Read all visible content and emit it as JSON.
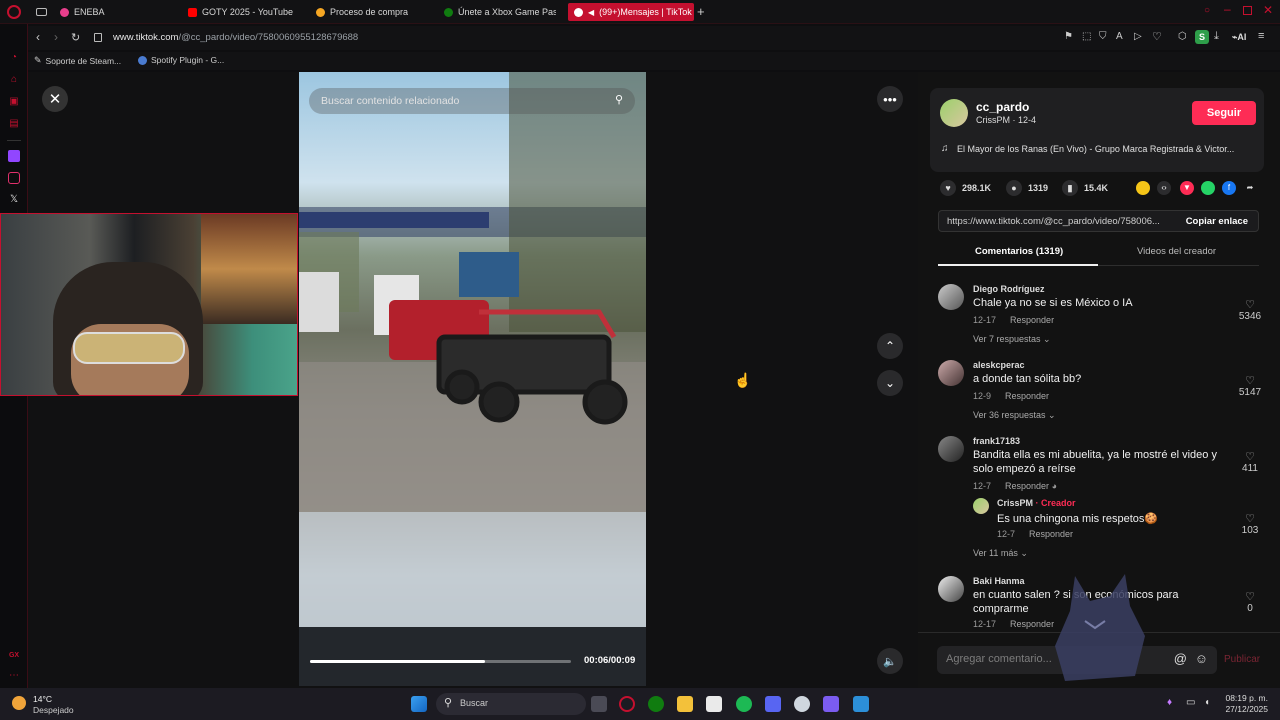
{
  "browser": {
    "tabs": [
      {
        "label": "ENEBA",
        "color": "#e83e8c"
      },
      {
        "label": "GOTY 2025 - YouTube",
        "color": "#ff0000"
      },
      {
        "label": "Proceso de compra",
        "color": "#f5a623"
      },
      {
        "label": "Únete a Xbox Game Pass",
        "color": "#107c10"
      },
      {
        "label": "(99+)Mensajes | TikTok",
        "color": "#ffffff"
      }
    ],
    "url_host": "www.tiktok.com",
    "url_path": "/@cc_pardo/video/7580060955128679688",
    "bookmarks": [
      "Soporte de Steam...",
      "Spotify Plugin - G..."
    ],
    "ai_label": "AI",
    "profile_initial": "S"
  },
  "video": {
    "search_placeholder": "Buscar contenido relacionado",
    "time": "00:06/00:09",
    "progress": 0.67
  },
  "creator": {
    "username": "cc_pardo",
    "subtitle": "CrissPM · 12-4",
    "follow_label": "Seguir",
    "music": "El Mayor de los Ranas (En Vivo) - Grupo Marca Registrada & Victor..."
  },
  "stats": {
    "likes": "298.1K",
    "comments": "1319",
    "saves": "15.4K"
  },
  "link": {
    "url": "https://www.tiktok.com/@cc_pardo/video/758006...",
    "copy_label": "Copiar enlace"
  },
  "panel_tabs": {
    "comments": "Comentarios (1319)",
    "creator_videos": "Videos del creador"
  },
  "comments": [
    {
      "user": "Diego Rodríguez",
      "text": "Chale ya no se si es México o IA",
      "date": "12-17",
      "reply": "Responder",
      "likes": "5346",
      "more": "Ver 7 respuestas"
    },
    {
      "user": "aleskcperac",
      "text": "a donde tan sólita bb?",
      "date": "12-9",
      "reply": "Responder",
      "likes": "5147",
      "more": "Ver 36 respuestas"
    },
    {
      "user": "frank17183",
      "text": "Bandita ella es mi abuelita, ya le mostré el video y solo empezó a reírse",
      "date": "12-7",
      "reply": "Responder",
      "likes": "411",
      "more": "Ver 11 más"
    },
    {
      "user": "Baki Hanma",
      "text": "en cuanto salen ? si son económicos para comprarme",
      "date": "12-17",
      "reply": "Responder",
      "likes": "0",
      "more": ""
    }
  ],
  "reply": {
    "user": "CrissPM",
    "creator_tag": "· Creador",
    "text": "Es una chingona mis respetos🍪",
    "date": "12-7",
    "reply": "Responder",
    "likes": "103"
  },
  "composer": {
    "placeholder": "Agregar comentario...",
    "publish": "Publicar"
  },
  "taskbar": {
    "weather_temp": "14°C",
    "weather_desc": "Despejado",
    "search_label": "Buscar",
    "time": "08:19 p. m.",
    "date": "27/12/2025"
  },
  "sidebar_label": "GX",
  "colors": {
    "accent": "#fe2c55",
    "opera": "#c4102f"
  }
}
